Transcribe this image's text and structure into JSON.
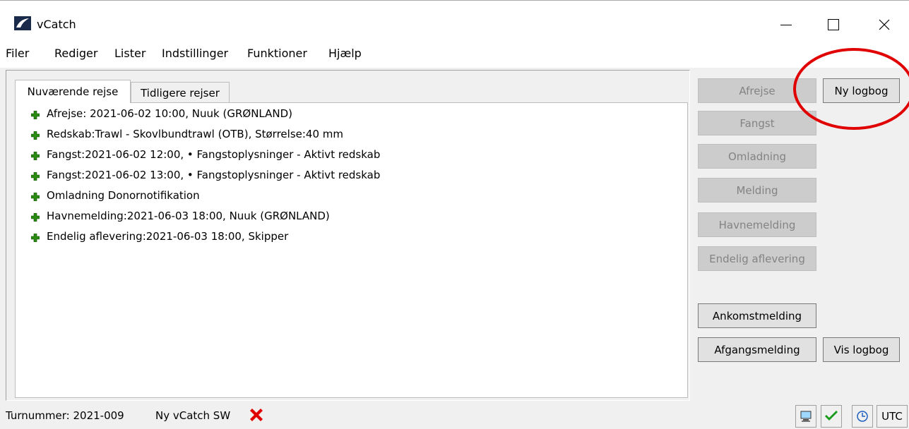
{
  "window": {
    "title": "vCatch",
    "icon": "vcatch-app-icon"
  },
  "menu": [
    "Filer",
    "Rediger",
    "Lister",
    "Indstillinger",
    "Funktioner",
    "Hjælp"
  ],
  "tabs": {
    "active": "Nuværende rejse",
    "inactive": "Tidligere rejser"
  },
  "entries": [
    "Afrejse: 2021-06-02 10:00,  Nuuk (GRØNLAND)",
    "Redskab:Trawl - Skovlbundtrawl (OTB), Størrelse:40 mm",
    "Fangst:2021-06-02 12:00, • Fangstoplysninger - Aktivt redskab",
    "Fangst:2021-06-02 13:00, • Fangstoplysninger - Aktivt redskab",
    "Omladning Donornotifikation",
    "Havnemelding:2021-06-03 18:00,  Nuuk (GRØNLAND)",
    "Endelig aflevering:2021-06-03 18:00,  Skipper"
  ],
  "buttons": {
    "afrejse": "Afrejse",
    "fangst": "Fangst",
    "omladning": "Omladning",
    "melding": "Melding",
    "havnemelding": "Havnemelding",
    "endelig": "Endelig aflevering",
    "ny_logbog": "Ny logbog",
    "ankomst": "Ankomstmelding",
    "afgang": "Afgangsmelding",
    "vis_logbog": "Vis logbog"
  },
  "status": {
    "turnummer": "Turnummer: 2021-009",
    "version": "Ny vCatch SW",
    "utc": "UTC"
  },
  "colors": {
    "plus_green": "#2a8a12",
    "annotation_red": "#e00000",
    "status_x_red": "#e00000",
    "check_green": "#1a9a1a"
  }
}
